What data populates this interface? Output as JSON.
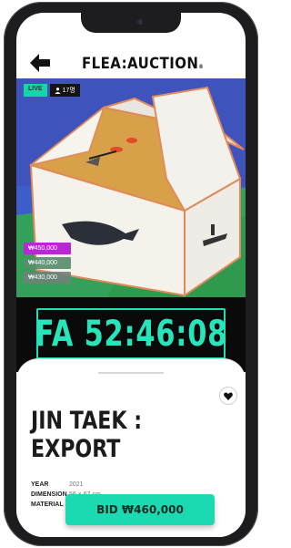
{
  "header": {
    "logo": "FLEA:AUCTION",
    "logo_mark": "®",
    "back_icon": "arrow-left-icon"
  },
  "status": {
    "live_label": "LIVE",
    "viewers": "17명",
    "viewers_icon": "person-icon"
  },
  "bids": [
    {
      "amount": "₩450,000"
    },
    {
      "amount": "₩440,000"
    },
    {
      "amount": "₩430,000"
    }
  ],
  "timer": {
    "text": "FA 52:46:08"
  },
  "artwork": {
    "title_line1": "JIN TAEK :",
    "title_line2": "EXPORT",
    "meta": [
      {
        "label": "YEAR",
        "value": "2021"
      },
      {
        "label": "DIMENSION",
        "value": "56 × 67 cm"
      },
      {
        "label": "MATERIAL",
        "value": ""
      }
    ]
  },
  "actions": {
    "bid_label": "BID ₩460,000",
    "like_icon": "heart-icon"
  },
  "colors": {
    "accent": "#1fe0b4",
    "top_bid": "#b826d6",
    "timer_bg": "#0a0a0a"
  }
}
